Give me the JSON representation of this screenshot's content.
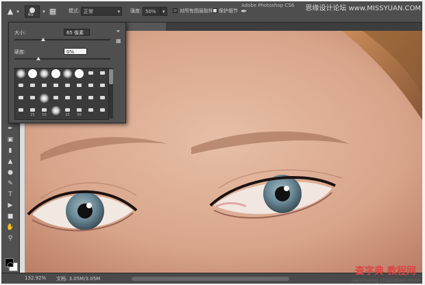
{
  "app": {
    "title": "Adobe Photoshop CS6"
  },
  "watermark_top": "思缘设计论坛 www.MISSYUAN.COM",
  "watermark_bottom": {
    "line1": "查字典 教程网",
    "line2": "jiaocheng.chazidian.com"
  },
  "options_bar": {
    "brush_size_badge": "65",
    "mode_label": "模式:",
    "mode_value": "正常",
    "strength_label": "强度:",
    "strength_value": "50%",
    "sample_all_label": "对所有图层取样",
    "protect_detail_label": "保护细节"
  },
  "brush_panel": {
    "size_label": "大小:",
    "size_value": "65 像素",
    "hardness_label": "硬度:",
    "hardness_value": "0%",
    "brush_numbers": [
      "",
      "",
      "",
      "",
      "",
      "",
      "",
      "",
      "",
      "",
      "",
      "",
      "",
      "",
      "",
      "",
      "",
      "",
      "",
      "",
      "",
      "",
      "",
      "",
      "",
      "25",
      "50",
      "",
      "25",
      "50",
      "",
      ""
    ]
  },
  "status_bar": {
    "zoom": "132.92%",
    "doc": "文档: 3.05M/3.05M"
  },
  "colors": {
    "ui_dark": "#3a3a3a",
    "panel": "#4f4f4f",
    "skin": "#d9a88f",
    "iris": "#6f8e9c"
  }
}
